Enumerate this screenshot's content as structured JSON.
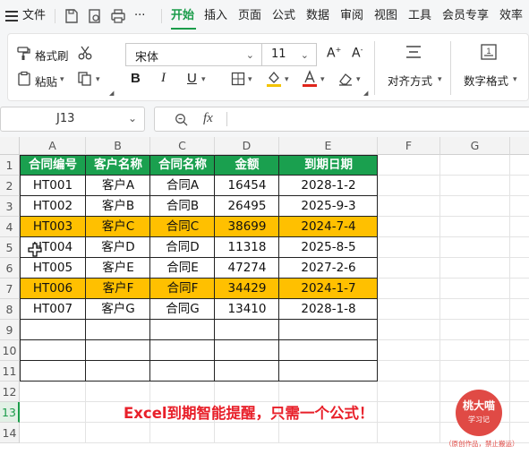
{
  "menubar": {
    "file": "文件",
    "tabs": [
      "开始",
      "插入",
      "页面",
      "公式",
      "数据",
      "审阅",
      "视图",
      "工具",
      "会员专享",
      "效率"
    ],
    "active_tab": "开始",
    "more": "···"
  },
  "ribbon": {
    "format_painter": "格式刷",
    "paste": "粘贴",
    "font_name": "宋体",
    "font_size": "11",
    "bold": "B",
    "italic": "I",
    "underline": "U",
    "align_label": "对齐方式",
    "number_label": "数字格式"
  },
  "formula_bar": {
    "name_box": "J13",
    "fx": "fx",
    "formula": ""
  },
  "grid": {
    "columns": [
      "A",
      "B",
      "C",
      "D",
      "E",
      "F",
      "G"
    ],
    "rows": [
      "1",
      "2",
      "3",
      "4",
      "5",
      "6",
      "7",
      "8",
      "9",
      "10",
      "11",
      "12",
      "13",
      "14"
    ],
    "selected_row": "13",
    "header": [
      "合同编号",
      "客户名称",
      "合同名称",
      "金额",
      "到期日期"
    ],
    "data": [
      [
        "HT001",
        "客户A",
        "合同A",
        "16454",
        "2028-1-2"
      ],
      [
        "HT002",
        "客户B",
        "合同B",
        "26495",
        "2025-9-3"
      ],
      [
        "HT003",
        "客户C",
        "合同C",
        "38699",
        "2024-7-4"
      ],
      [
        "HT004",
        "客户D",
        "合同D",
        "11318",
        "2025-8-5"
      ],
      [
        "HT005",
        "客户E",
        "合同E",
        "47274",
        "2027-2-6"
      ],
      [
        "HT006",
        "客户F",
        "合同F",
        "34429",
        "2024-1-7"
      ],
      [
        "HT007",
        "客户G",
        "合同G",
        "13410",
        "2028-1-8"
      ]
    ],
    "highlight_rows": [
      2,
      5
    ],
    "colors": {
      "header_bg": "#1aa04f",
      "highlight_bg": "#ffc000",
      "accent": "#1b9c4a"
    }
  },
  "caption": "Excel到期智能提醒，只需一个公式！",
  "stamp": {
    "name": "桃大喵",
    "sub": "学习记",
    "note": "（原创作品，禁止搬运）"
  }
}
